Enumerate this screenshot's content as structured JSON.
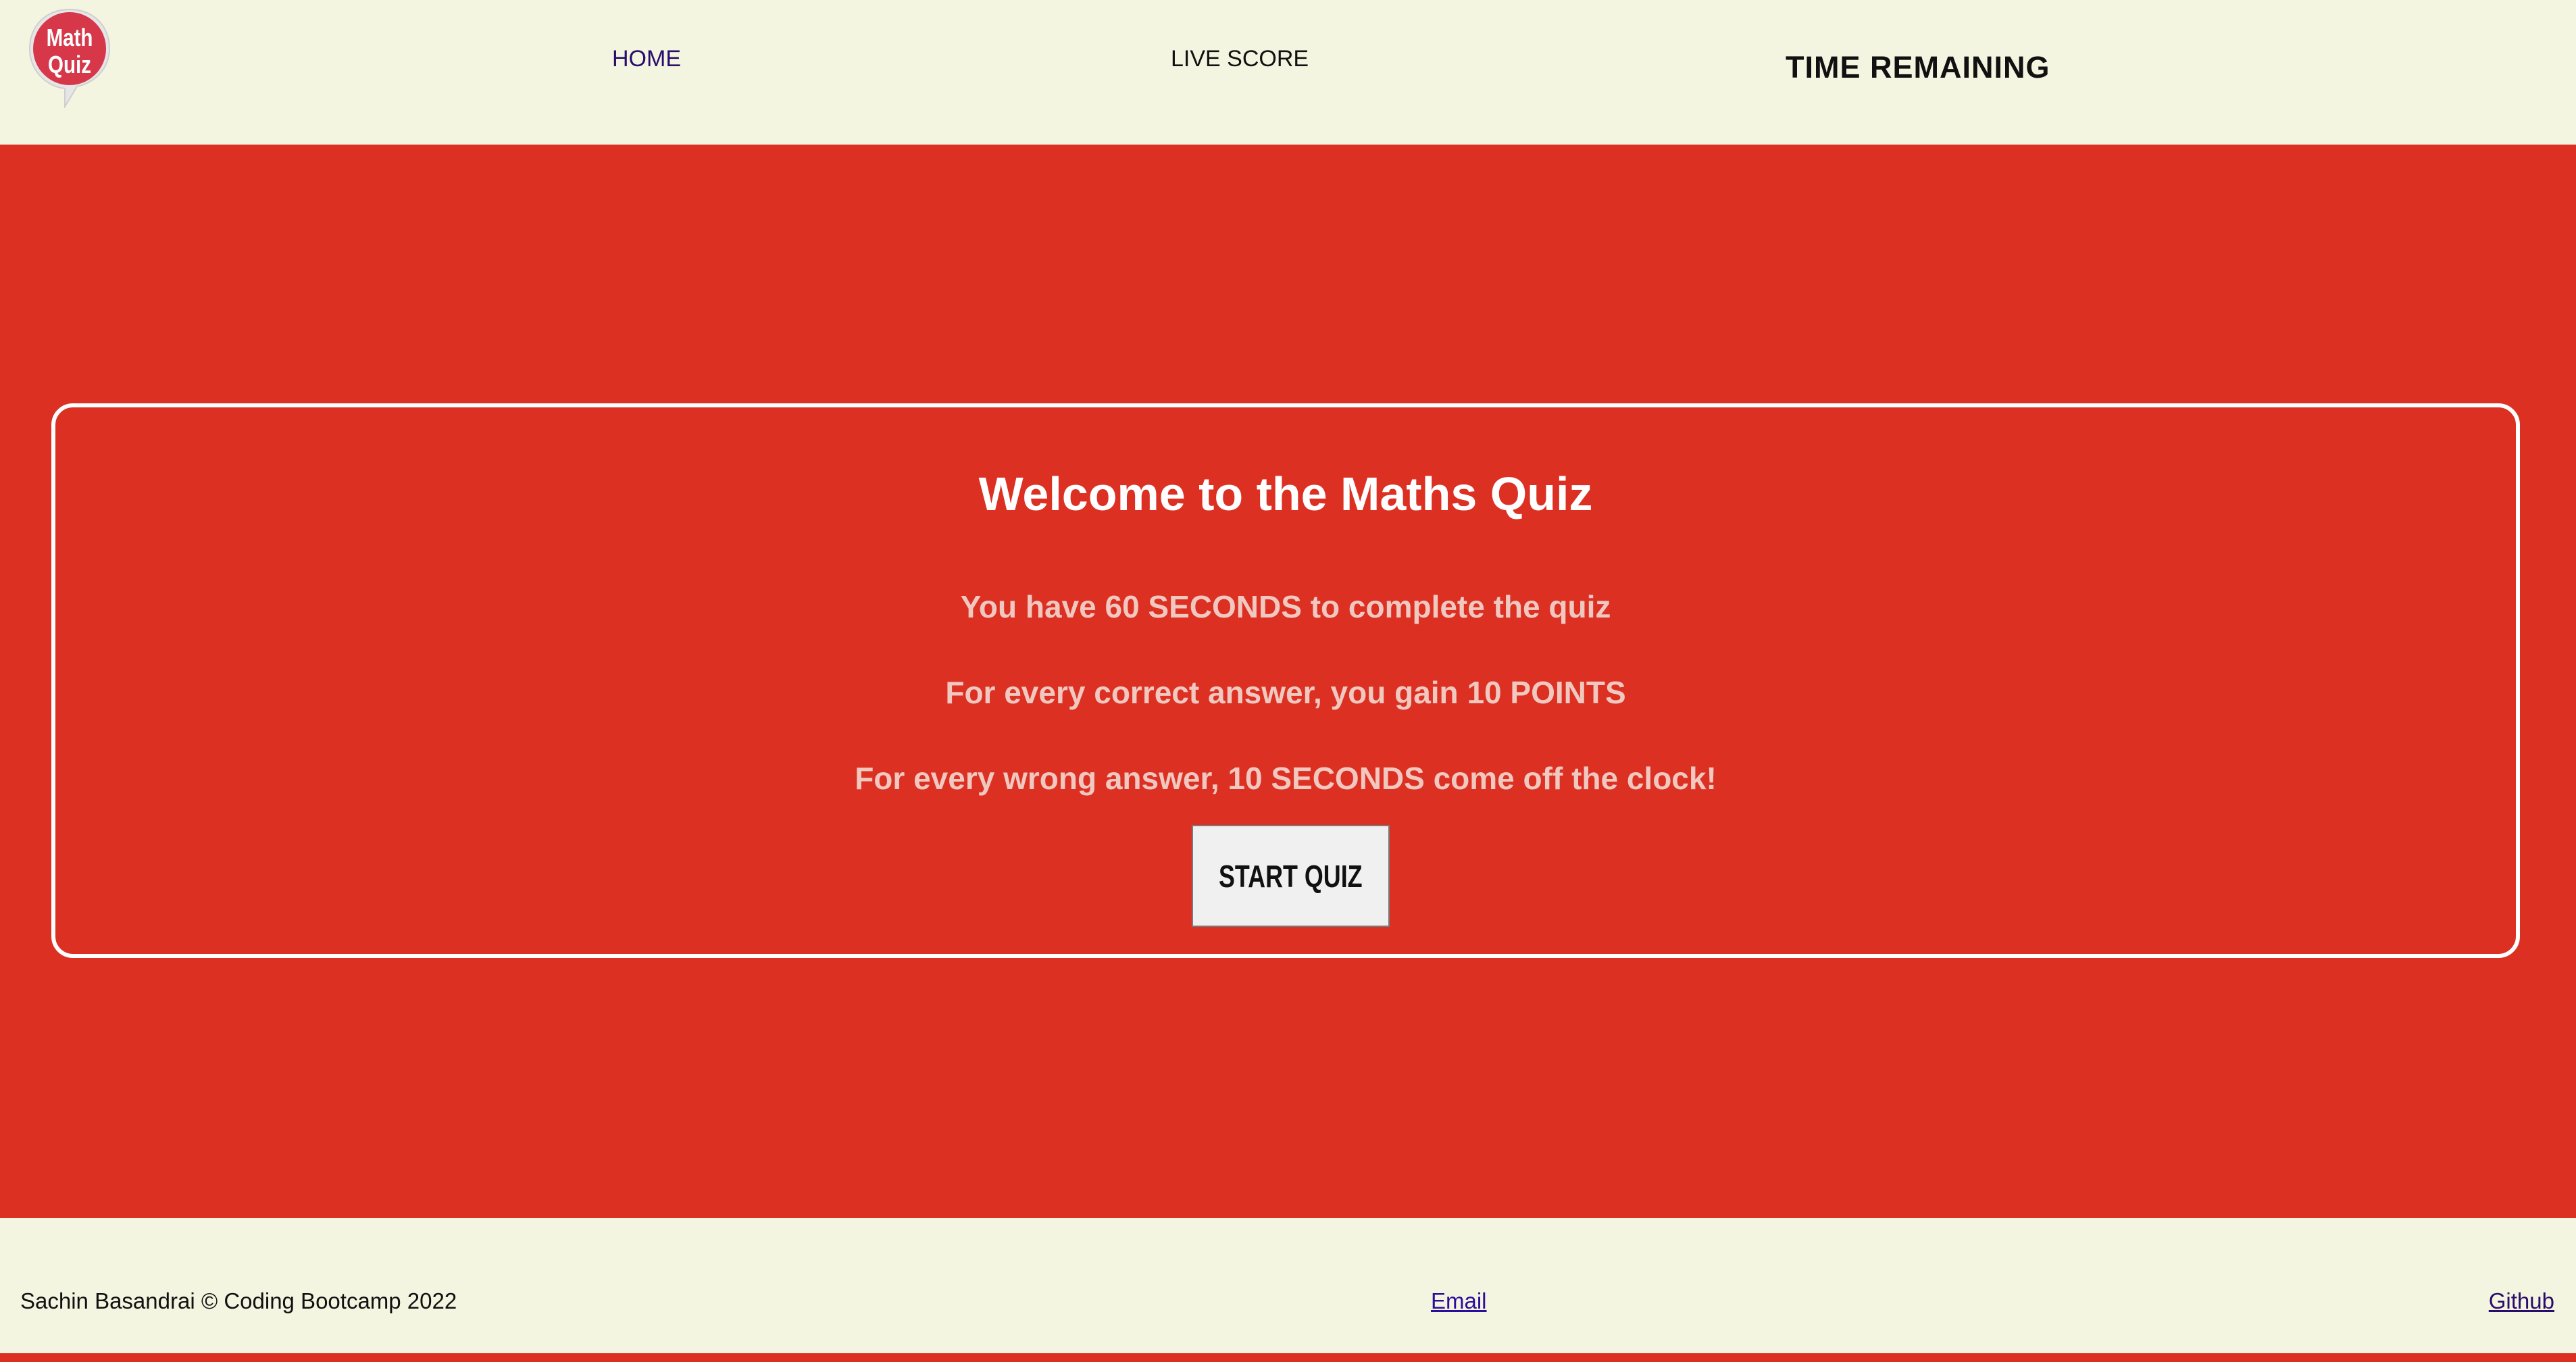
{
  "logo": {
    "line1": "Math",
    "line2": "Quiz",
    "color": "#d6384a"
  },
  "nav": {
    "home_label": "HOME",
    "live_score_label": "LIVE SCORE",
    "timer_label": "TIME REMAINING"
  },
  "card": {
    "title": "Welcome to the Maths Quiz",
    "rules": [
      "You have 60 SECONDS to complete the quiz",
      "For every correct answer, you gain 10 POINTS",
      "For every wrong answer, 10 SECONDS come off the clock!"
    ],
    "start_button_label": "START QUIZ"
  },
  "footer": {
    "copyright": "Sachin Basandrai © Coding Bootcamp 2022",
    "email_label": "Email",
    "github_label": "Github"
  },
  "colors": {
    "background": "#f3f5e0",
    "accent_red": "#dc3023",
    "text_white": "#ffffff",
    "rule_text": "#f0c8c0"
  }
}
